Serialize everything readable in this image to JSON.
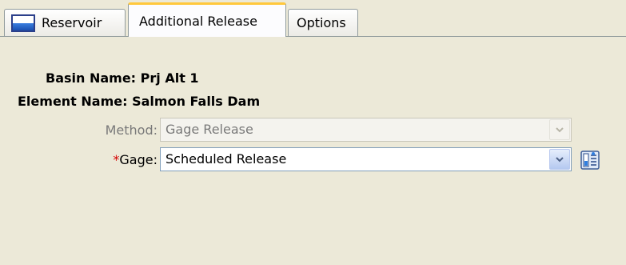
{
  "tabs": [
    {
      "label": "Reservoir",
      "icon": "reservoir-icon"
    },
    {
      "label": "Additional Release",
      "selected": true
    },
    {
      "label": "Options"
    }
  ],
  "form": {
    "basin_label": "Basin Name:",
    "basin_value": "Prj Alt 1",
    "element_label": "Element Name:",
    "element_value": "Salmon Falls Dam",
    "method_label": "Method:",
    "method_value": "Gage Release",
    "gage_required_mark": "*",
    "gage_label": "Gage:",
    "gage_value": "Scheduled Release"
  },
  "colors": {
    "background": "#ece9d8",
    "selected_tab_accent": "#ffc83c",
    "required_mark": "#d40000"
  }
}
